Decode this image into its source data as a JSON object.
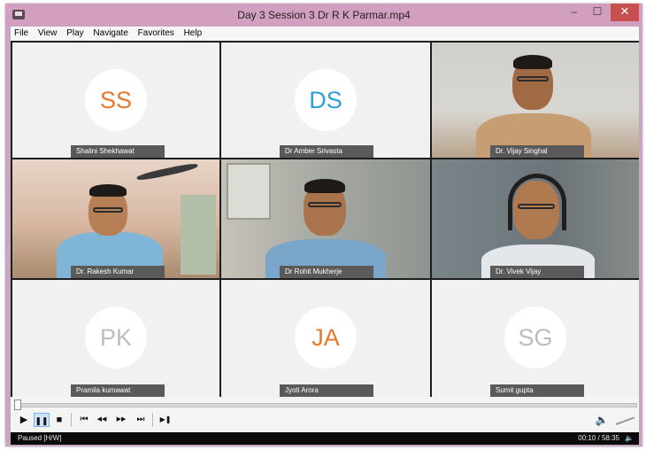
{
  "window": {
    "title": "Day 3 Session 3 Dr R K Parmar.mp4",
    "minimize": "–",
    "maximize": "☐",
    "close": "✕"
  },
  "menu": [
    "File",
    "View",
    "Play",
    "Navigate",
    "Favorites",
    "Help"
  ],
  "tiles": [
    {
      "type": "avatar",
      "initials": "SS",
      "name": "Shalini Shekhawat",
      "color": "#e8772e"
    },
    {
      "type": "avatar",
      "initials": "DS",
      "name": "Dr Amber Srivasta",
      "color": "#2f9fd8"
    },
    {
      "type": "video",
      "name": "Dr. Vijay Singhal"
    },
    {
      "type": "video",
      "name": "Dr. Rakesh Kumar"
    },
    {
      "type": "video",
      "name": "Dr Rohit Mukherje"
    },
    {
      "type": "video",
      "name": "Dr. Vivek Vijay"
    },
    {
      "type": "avatar",
      "initials": "PK",
      "name": "Pramila kumawat",
      "color": "#bdbdbd"
    },
    {
      "type": "avatar",
      "initials": "JA",
      "name": "Jyoti Arora",
      "color": "#e8772e"
    },
    {
      "type": "avatar",
      "initials": "SG",
      "name": "Sumit gupta",
      "color": "#bdbdbd"
    }
  ],
  "controls": {
    "play": "▶",
    "pause": "❚❚",
    "stop": "■",
    "skip_back": "⏮",
    "rewind": "◀◀",
    "fast_forward": "▶▶",
    "skip_forward": "⏭",
    "frame_step": "▶❚",
    "volume": "🔈"
  },
  "status": {
    "state": "Paused [H/W]",
    "time": "00:10 / 58:35",
    "volume_icon": "🔈"
  }
}
